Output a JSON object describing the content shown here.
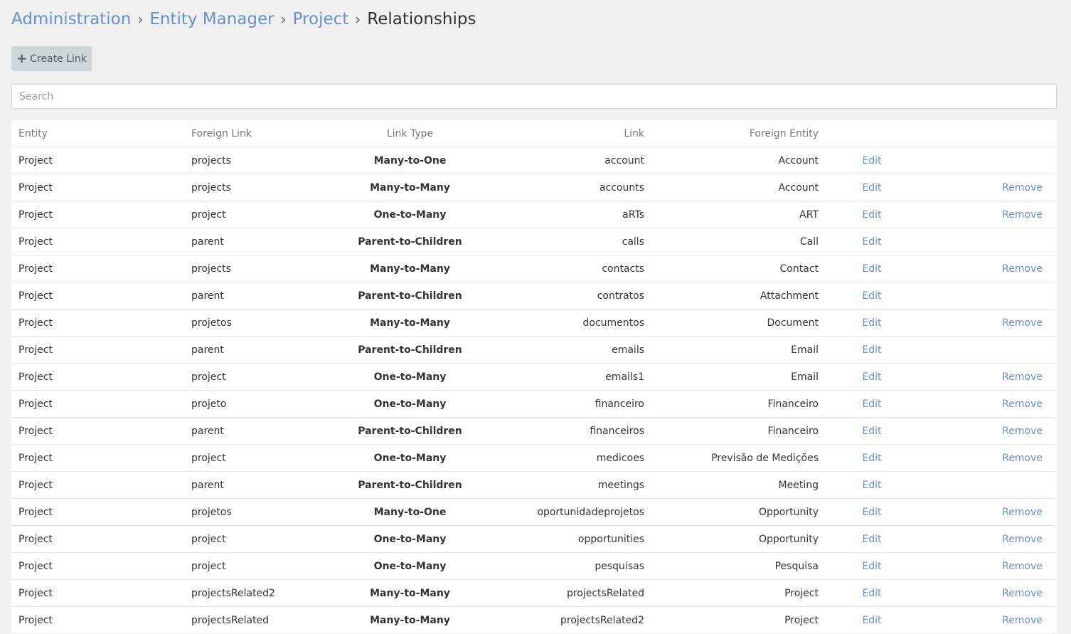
{
  "breadcrumb": {
    "items": [
      "Administration",
      "Entity Manager",
      "Project"
    ],
    "separator": "›",
    "current": "Relationships"
  },
  "toolbar": {
    "create_label": "Create Link",
    "create_icon": "plus-icon"
  },
  "search": {
    "placeholder": "Search",
    "value": ""
  },
  "colors": {
    "link": "#6b8fc7",
    "button_bg": "#cdd6db",
    "page_bg": "#f0f0f0"
  },
  "table": {
    "headers": [
      "Entity",
      "Foreign Link",
      "Link Type",
      "Link",
      "Foreign Entity"
    ],
    "edit_label": "Edit",
    "rows": [
      {
        "entity": "Project",
        "foreign_link": "projects",
        "link_type": "Many-to-One",
        "link": "account",
        "foreign_entity": "Account",
        "remove": ""
      },
      {
        "entity": "Project",
        "foreign_link": "projects",
        "link_type": "Many-to-Many",
        "link": "accounts",
        "foreign_entity": "Account",
        "remove": "Remove"
      },
      {
        "entity": "Project",
        "foreign_link": "project",
        "link_type": "One-to-Many",
        "link": "aRTs",
        "foreign_entity": "ART",
        "remove": "Remove"
      },
      {
        "entity": "Project",
        "foreign_link": "parent",
        "link_type": "Parent-to-Children",
        "link": "calls",
        "foreign_entity": "Call",
        "remove": ""
      },
      {
        "entity": "Project",
        "foreign_link": "projects",
        "link_type": "Many-to-Many",
        "link": "contacts",
        "foreign_entity": "Contact",
        "remove": "Remove"
      },
      {
        "entity": "Project",
        "foreign_link": "parent",
        "link_type": "Parent-to-Children",
        "link": "contratos",
        "foreign_entity": "Attachment",
        "remove": ""
      },
      {
        "entity": "Project",
        "foreign_link": "projetos",
        "link_type": "Many-to-Many",
        "link": "documentos",
        "foreign_entity": "Document",
        "remove": "Remove"
      },
      {
        "entity": "Project",
        "foreign_link": "parent",
        "link_type": "Parent-to-Children",
        "link": "emails",
        "foreign_entity": "Email",
        "remove": ""
      },
      {
        "entity": "Project",
        "foreign_link": "project",
        "link_type": "One-to-Many",
        "link": "emails1",
        "foreign_entity": "Email",
        "remove": "Remove"
      },
      {
        "entity": "Project",
        "foreign_link": "projeto",
        "link_type": "One-to-Many",
        "link": "financeiro",
        "foreign_entity": "Financeiro",
        "remove": "Remove"
      },
      {
        "entity": "Project",
        "foreign_link": "parent",
        "link_type": "Parent-to-Children",
        "link": "financeiros",
        "foreign_entity": "Financeiro",
        "remove": "Remove"
      },
      {
        "entity": "Project",
        "foreign_link": "project",
        "link_type": "One-to-Many",
        "link": "medicoes",
        "foreign_entity": "Previsão de Medições",
        "remove": "Remove"
      },
      {
        "entity": "Project",
        "foreign_link": "parent",
        "link_type": "Parent-to-Children",
        "link": "meetings",
        "foreign_entity": "Meeting",
        "remove": ""
      },
      {
        "entity": "Project",
        "foreign_link": "projetos",
        "link_type": "Many-to-One",
        "link": "oportunidadeprojetos",
        "foreign_entity": "Opportunity",
        "remove": "Remove"
      },
      {
        "entity": "Project",
        "foreign_link": "project",
        "link_type": "One-to-Many",
        "link": "opportunities",
        "foreign_entity": "Opportunity",
        "remove": "Remove"
      },
      {
        "entity": "Project",
        "foreign_link": "project",
        "link_type": "One-to-Many",
        "link": "pesquisas",
        "foreign_entity": "Pesquisa",
        "remove": "Remove"
      },
      {
        "entity": "Project",
        "foreign_link": "projectsRelated2",
        "link_type": "Many-to-Many",
        "link": "projectsRelated",
        "foreign_entity": "Project",
        "remove": "Remove"
      },
      {
        "entity": "Project",
        "foreign_link": "projectsRelated",
        "link_type": "Many-to-Many",
        "link": "projectsRelated2",
        "foreign_entity": "Project",
        "remove": "Remove"
      }
    ]
  }
}
